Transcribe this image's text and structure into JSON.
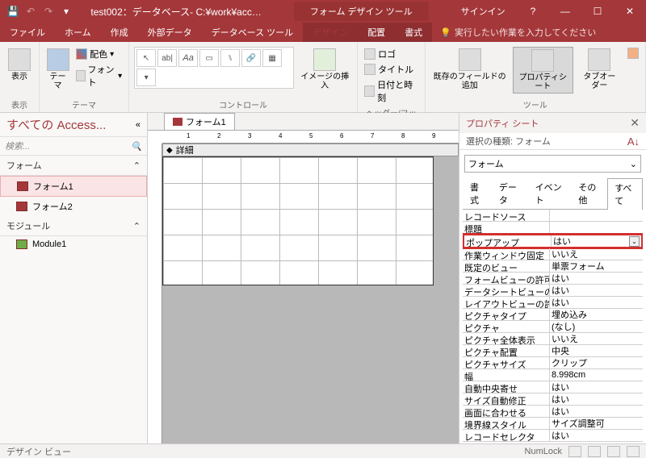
{
  "titlebar": {
    "filename": "test002：データベース- C:¥work¥acc…",
    "tools_context": "フォーム デザイン ツール",
    "signin": "サインイン"
  },
  "ribbon_tabs": [
    "ファイル",
    "ホーム",
    "作成",
    "外部データ",
    "データベース ツール",
    "デザイン",
    "配置",
    "書式"
  ],
  "tell_me": "実行したい作業を入力してください",
  "ribbon": {
    "view": "表示",
    "view_grp": "表示",
    "themes": "テーマ",
    "colors": "配色",
    "fonts": "フォント",
    "themes_grp": "テーマ",
    "insert_image": "イメージの挿入",
    "controls_grp": "コントロール",
    "logo": "ロゴ",
    "title": "タイトル",
    "datetime": "日付と時刻",
    "hf_grp": "ヘッダー/フッター",
    "add_field": "既存のフィールドの追加",
    "propsheet": "プロパティシート",
    "taborder": "タブオーダー",
    "tools_grp": "ツール"
  },
  "nav": {
    "title": "すべての Access...",
    "search": "検索...",
    "grp_forms": "フォーム",
    "form1": "フォーム1",
    "form2": "フォーム2",
    "grp_modules": "モジュール",
    "module1": "Module1"
  },
  "doc_tab": "フォーム1",
  "section_detail": "詳細",
  "ruler_marks": [
    "1",
    "2",
    "3",
    "4",
    "5",
    "6",
    "7",
    "8",
    "9"
  ],
  "propsheet": {
    "title": "プロパティ シート",
    "seltype_label": "選択の種類: ",
    "seltype_value": "フォーム",
    "combo": "フォーム",
    "tabs": [
      "書式",
      "データ",
      "イベント",
      "その他",
      "すべて"
    ],
    "props": [
      {
        "n": "レコードソース",
        "v": ""
      },
      {
        "n": "標題",
        "v": ""
      },
      {
        "n": "ポップアップ",
        "v": "はい",
        "hl": true,
        "dd": true
      },
      {
        "n": "作業ウィンドウ固定",
        "v": "いいえ"
      },
      {
        "n": "既定のビュー",
        "v": "単票フォーム"
      },
      {
        "n": "フォームビューの許可",
        "v": "はい"
      },
      {
        "n": "データシートビューの許可",
        "v": "はい"
      },
      {
        "n": "レイアウトビューの許可",
        "v": "はい"
      },
      {
        "n": "ピクチャタイプ",
        "v": "埋め込み"
      },
      {
        "n": "ピクチャ",
        "v": "(なし)"
      },
      {
        "n": "ピクチャ全体表示",
        "v": "いいえ"
      },
      {
        "n": "ピクチャ配置",
        "v": "中央"
      },
      {
        "n": "ピクチャサイズ",
        "v": "クリップ"
      },
      {
        "n": "幅",
        "v": "8.998cm"
      },
      {
        "n": "自動中央寄せ",
        "v": "はい"
      },
      {
        "n": "サイズ自動修正",
        "v": "はい"
      },
      {
        "n": "画面に合わせる",
        "v": "はい"
      },
      {
        "n": "境界線スタイル",
        "v": "サイズ調整可"
      },
      {
        "n": "レコードセレクタ",
        "v": "はい"
      }
    ]
  },
  "statusbar": {
    "left": "デザイン ビュー",
    "numlock": "NumLock"
  }
}
